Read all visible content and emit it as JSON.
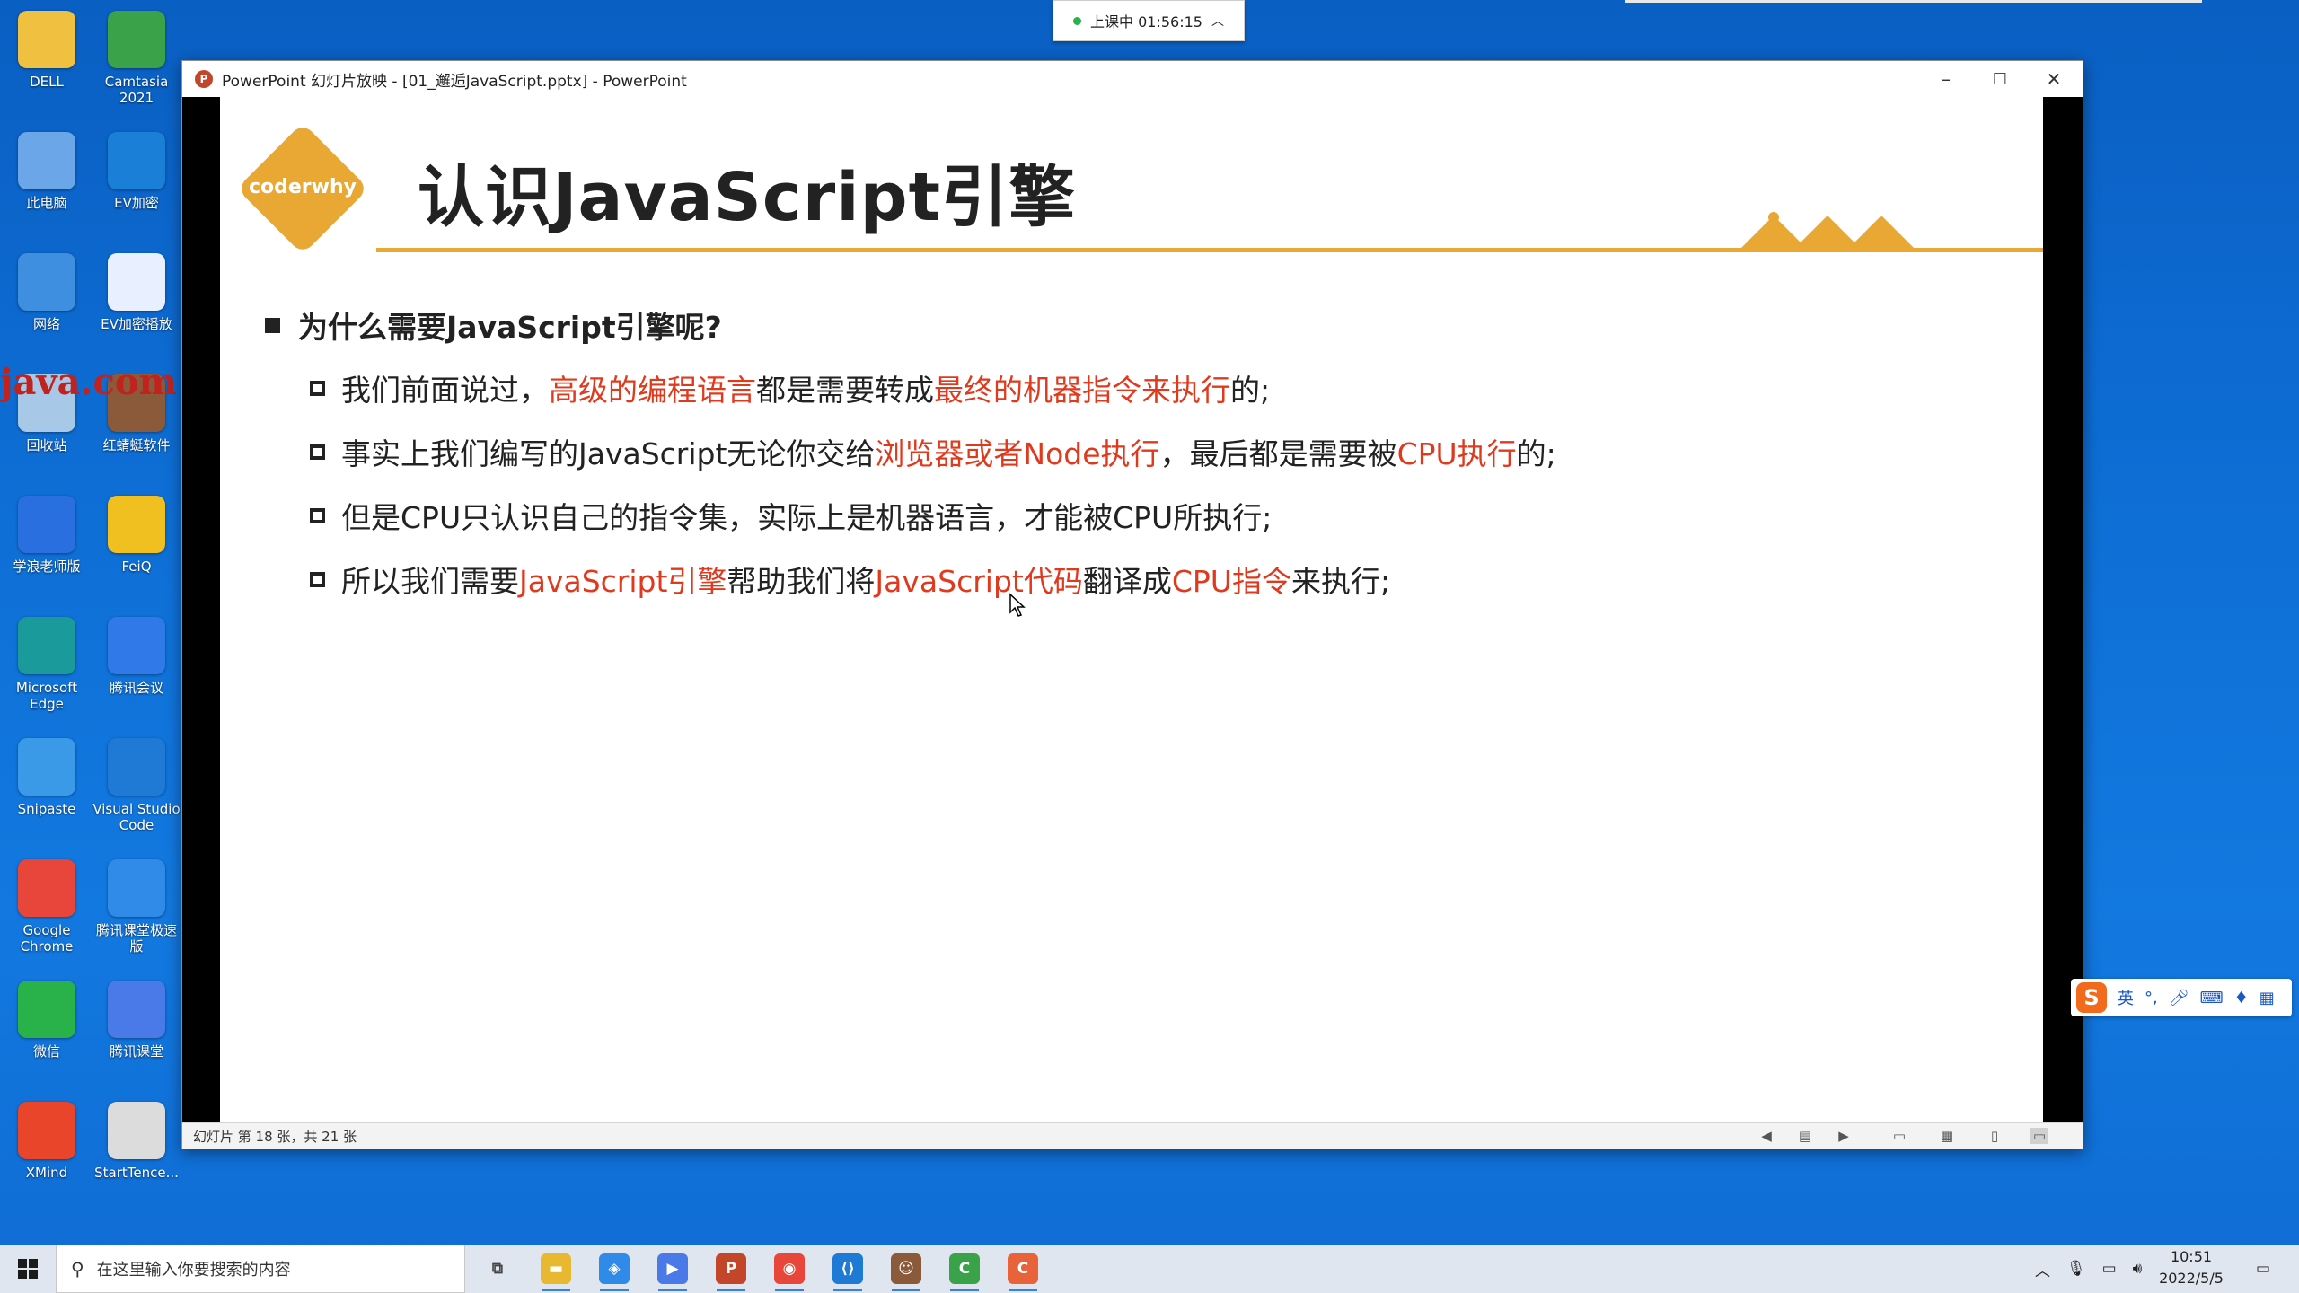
{
  "desktop": {
    "icons": [
      {
        "label": "DELL",
        "icon": "folder-icon",
        "color": "#f0c040"
      },
      {
        "label": "Camtasia 2021",
        "icon": "camtasia-icon",
        "color": "#3aa34a"
      },
      {
        "label": "此电脑",
        "icon": "computer-icon",
        "color": "#6aa6e8"
      },
      {
        "label": "EV加密",
        "icon": "ev-shield-icon",
        "color": "#1a7fd6"
      },
      {
        "label": "网络",
        "icon": "network-icon",
        "color": "#3e8fe0"
      },
      {
        "label": "EV加密播放",
        "icon": "ev-player-icon",
        "color": "#e8f0ff"
      },
      {
        "label": "回收站",
        "icon": "recycle-bin-icon",
        "color": "#a8c8e8"
      },
      {
        "label": "红蜻蜓软件",
        "icon": "dragonfly-app-icon",
        "color": "#8a5a3a"
      },
      {
        "label": "学浪老师版",
        "icon": "xuelang-icon",
        "color": "#2a6fe0"
      },
      {
        "label": "FeiQ",
        "icon": "feiq-icon",
        "color": "#f0c020"
      },
      {
        "label": "Microsoft Edge",
        "icon": "edge-icon",
        "color": "#1a9a9a"
      },
      {
        "label": "腾讯会议",
        "icon": "tencent-meeting-icon",
        "color": "#2f7ae8"
      },
      {
        "label": "Snipaste",
        "icon": "snipaste-icon",
        "color": "#3a9ae8"
      },
      {
        "label": "Visual Studio Code",
        "icon": "vscode-icon",
        "color": "#1f7ad6"
      },
      {
        "label": "Google Chrome",
        "icon": "chrome-icon",
        "color": "#e8463a"
      },
      {
        "label": "腾讯课堂极速版",
        "icon": "tencent-classroom-fast-icon",
        "color": "#2f8ae8"
      },
      {
        "label": "微信",
        "icon": "wechat-icon",
        "color": "#2ab24a"
      },
      {
        "label": "腾讯课堂",
        "icon": "tencent-classroom-icon",
        "color": "#4a7ae8"
      },
      {
        "label": "XMind",
        "icon": "xmind-icon",
        "color": "#e8452a"
      },
      {
        "label": "StartTence...",
        "icon": "start-tencent-icon",
        "color": "#dcdcdc"
      }
    ],
    "watermark": "java.com"
  },
  "timer": {
    "label": "上课中 01:56:15",
    "indicator_color": "#2ab24a"
  },
  "window": {
    "title": "PowerPoint 幻灯片放映 - [01_邂逅JavaScript.pptx] - PowerPoint",
    "minimize": "–",
    "maximize": "☐",
    "close": "✕"
  },
  "slide": {
    "logo": "coderwhy",
    "title": "认识JavaScript引擎",
    "question": "为什么需要JavaScript引擎呢?",
    "bullets": [
      [
        {
          "t": "我们前面说过，",
          "hl": false
        },
        {
          "t": "高级的编程语言",
          "hl": true
        },
        {
          "t": "都是需要转成",
          "hl": false
        },
        {
          "t": "最终的机器指令来执行",
          "hl": true
        },
        {
          "t": "的;",
          "hl": false
        }
      ],
      [
        {
          "t": "事实上我们编写的JavaScript无论你交给",
          "hl": false
        },
        {
          "t": "浏览器或者Node执行",
          "hl": true
        },
        {
          "t": "，最后都是需要被",
          "hl": false
        },
        {
          "t": "CPU执行",
          "hl": true
        },
        {
          "t": "的;",
          "hl": false
        }
      ],
      [
        {
          "t": "但是CPU只认识自己的指令集，实际上是机器语言，才能被CPU所执行;",
          "hl": false
        }
      ],
      [
        {
          "t": "所以我们需要",
          "hl": false
        },
        {
          "t": "JavaScript引擎",
          "hl": true
        },
        {
          "t": "帮助我们将",
          "hl": false
        },
        {
          "t": "JavaScript代码",
          "hl": true
        },
        {
          "t": "翻译成",
          "hl": false
        },
        {
          "t": "CPU指令",
          "hl": true
        },
        {
          "t": "来执行;",
          "hl": false
        }
      ]
    ],
    "accent": "#e8a833",
    "highlight": "#e03a1e"
  },
  "status": {
    "slide_info": "幻灯片 第 18 张，共 21 张"
  },
  "ime": {
    "lang": "英",
    "punct": "°,",
    "logo": "S"
  },
  "taskbar": {
    "search_placeholder": "在这里输入你要搜索的内容",
    "apps": [
      {
        "name": "task-view",
        "glyph": "⧉",
        "color": "#444"
      },
      {
        "name": "file-explorer",
        "glyph": "▬",
        "color": "#e8b830"
      },
      {
        "name": "tencent-classroom-fast",
        "glyph": "◈",
        "color": "#2f8ae8"
      },
      {
        "name": "tencent-classroom",
        "glyph": "▶",
        "color": "#4a7ae8"
      },
      {
        "name": "powerpoint",
        "glyph": "P",
        "color": "#c4462a"
      },
      {
        "name": "chrome",
        "glyph": "◉",
        "color": "#e8463a"
      },
      {
        "name": "vscode",
        "glyph": "⟨⟩",
        "color": "#1f7ad6"
      },
      {
        "name": "dragonfly",
        "glyph": "☺",
        "color": "#8a5a3a"
      },
      {
        "name": "camtasia",
        "glyph": "C",
        "color": "#3aa34a"
      },
      {
        "name": "camtasia-recorder",
        "glyph": "C",
        "color": "#e8623a"
      }
    ],
    "time": "10:51",
    "date": "2022/5/5"
  }
}
